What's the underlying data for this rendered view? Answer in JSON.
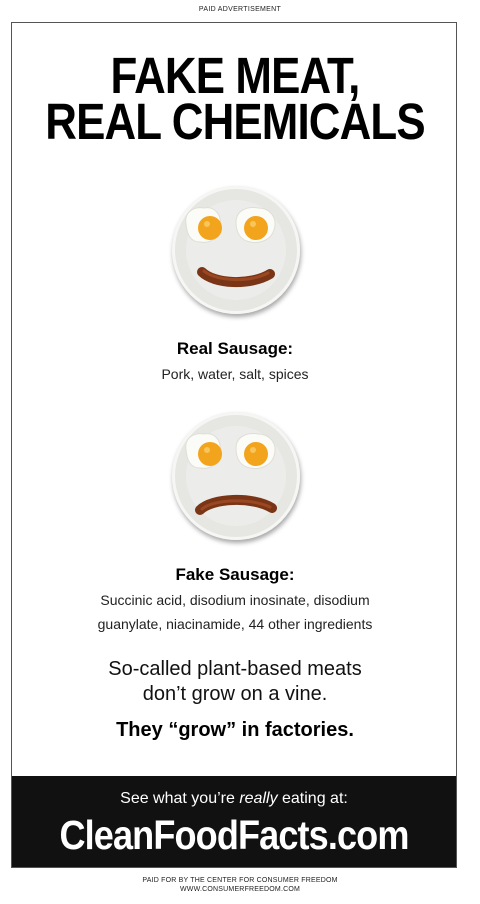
{
  "top_label": "PAID ADVERTISEMENT",
  "headline": {
    "line1": "FAKE MEAT,",
    "line2": "REAL CHEMICALS"
  },
  "real": {
    "title": "Real Sausage:",
    "ingredients": "Pork, water, salt, spices",
    "plate_icon": "smiley-plate-icon"
  },
  "fake": {
    "title": "Fake Sausage:",
    "ingredients_line1": "Succinic acid, disodium inosinate, disodium",
    "ingredients_line2": "guanylate, niacinamide, 44 other ingredients",
    "plate_icon": "frowny-plate-icon"
  },
  "tagline": {
    "line1": "So-called plant-based meats",
    "line2": "don’t grow on a vine.",
    "bold": "They “grow” in factories."
  },
  "footer": {
    "cta_prefix": "See what you’re ",
    "cta_emphasis": "really",
    "cta_suffix": " eating at:",
    "url": "CleanFoodFacts.com"
  },
  "credit": {
    "line1": "PAID FOR BY THE CENTER FOR CONSUMER FREEDOM",
    "line2": "WWW.CONSUMERFREEDOM.COM"
  },
  "colors": {
    "background": "#ffffff",
    "footer_bar": "#111111",
    "yolk": "#f2a41c",
    "sausage": "#8a3d1c"
  }
}
